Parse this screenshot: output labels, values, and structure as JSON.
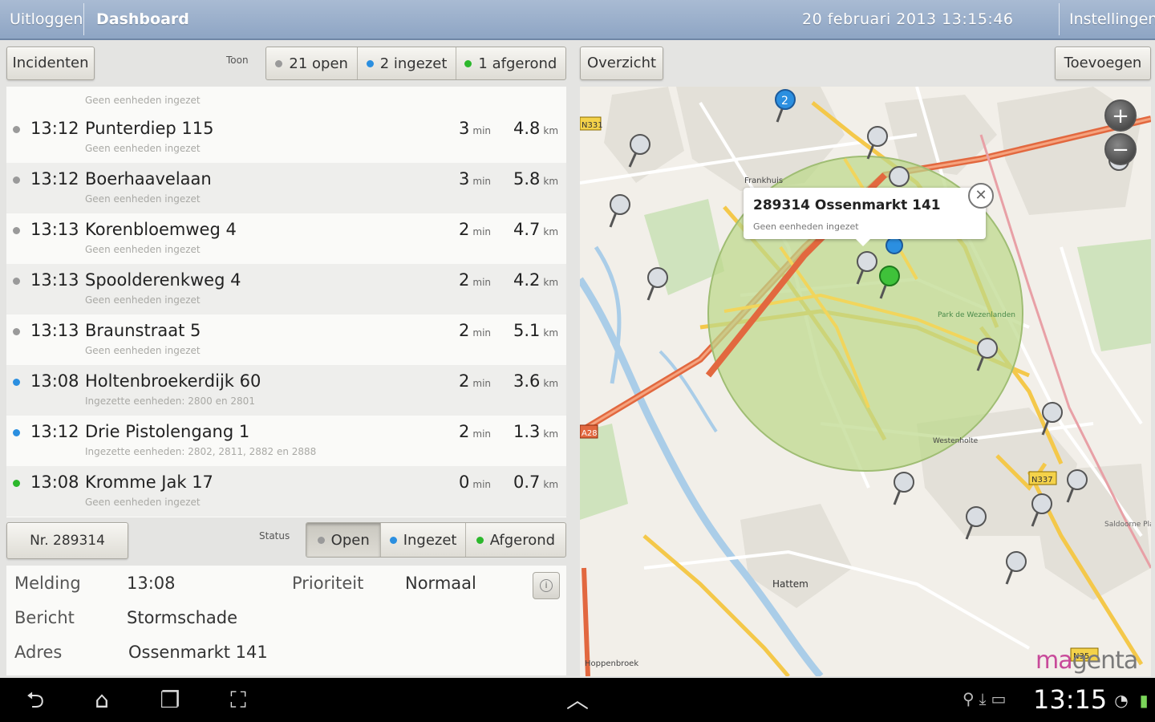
{
  "header": {
    "logout_label": "Uitloggen",
    "title": "Dashboard",
    "datetime": "20 februari 2013   13:15:46",
    "settings_label": "Instellingen"
  },
  "toolbar": {
    "incidents_label": "Incidenten",
    "show_label": "Toon",
    "filters": [
      {
        "label": "21 open",
        "dot_color": "#9a9a9a"
      },
      {
        "label": "2 ingezet",
        "dot_color": "#2b8fe0"
      },
      {
        "label": "1 afgerond",
        "dot_color": "#2cb82c"
      }
    ],
    "overview_label": "Overzicht",
    "add_label": "Toevoegen"
  },
  "list": {
    "top_cut_sub": "Geen eenheden ingezet",
    "rows": [
      {
        "status_color": "#9a9a9a",
        "time": "13:12",
        "address": "Punterdiep 115",
        "min": "3",
        "min_unit": "min",
        "km": "4.8",
        "km_unit": "km",
        "sub": "Geen eenheden ingezet"
      },
      {
        "status_color": "#9a9a9a",
        "time": "13:12",
        "address": "Boerhaavelaan",
        "min": "3",
        "min_unit": "min",
        "km": "5.8",
        "km_unit": "km",
        "sub": "Geen eenheden ingezet"
      },
      {
        "status_color": "#9a9a9a",
        "time": "13:13",
        "address": "Korenbloemweg 4",
        "min": "2",
        "min_unit": "min",
        "km": "4.7",
        "km_unit": "km",
        "sub": "Geen eenheden ingezet"
      },
      {
        "status_color": "#9a9a9a",
        "time": "13:13",
        "address": "Spoolderenkweg 4",
        "min": "2",
        "min_unit": "min",
        "km": "4.2",
        "km_unit": "km",
        "sub": "Geen eenheden ingezet"
      },
      {
        "status_color": "#9a9a9a",
        "time": "13:13",
        "address": "Braunstraat 5",
        "min": "2",
        "min_unit": "min",
        "km": "5.1",
        "km_unit": "km",
        "sub": "Geen eenheden ingezet"
      },
      {
        "status_color": "#2b8fe0",
        "time": "13:08",
        "address": "Holtenbroekerdijk 60",
        "min": "2",
        "min_unit": "min",
        "km": "3.6",
        "km_unit": "km",
        "sub": "Ingezette eenheden: 2800 en 2801"
      },
      {
        "status_color": "#2b8fe0",
        "time": "13:12",
        "address": "Drie Pistolengang 1",
        "min": "2",
        "min_unit": "min",
        "km": "1.3",
        "km_unit": "km",
        "sub": "Ingezette eenheden: 2802, 2811, 2882 en 2888"
      },
      {
        "status_color": "#2cb82c",
        "time": "13:08",
        "address": "Kromme Jak 17",
        "min": "0",
        "min_unit": "min",
        "km": "0.7",
        "km_unit": "km",
        "sub": "Geen eenheden ingezet"
      }
    ]
  },
  "detail_bar": {
    "number_label": "Nr. 289314",
    "status_label": "Status",
    "statuses": [
      {
        "label": "Open",
        "dot_color": "#9a9a9a",
        "active": true
      },
      {
        "label": "Ingezet",
        "dot_color": "#2b8fe0",
        "active": false
      },
      {
        "label": "Afgerond",
        "dot_color": "#2cb82c",
        "active": false
      }
    ]
  },
  "detail": {
    "melding_label": "Melding",
    "melding_value": "13:08",
    "priority_label": "Prioriteit",
    "priority_value": "Normaal",
    "bericht_label": "Bericht",
    "bericht_value": "Stormschade",
    "adres_label": "Adres",
    "adres_value": "Ossenmarkt 141"
  },
  "map": {
    "popup_title": "289314 Ossenmarkt 141",
    "popup_sub": "Geen eenheden ingezet",
    "zoom_in": "+",
    "zoom_out": "−",
    "place_hattem": "Hattem",
    "place_frankhuis": "Frankhuis",
    "place_park": "Park de Wezenlanden",
    "place_westenholte": "Westenholte",
    "place_saldoorne": "Saldoorne Plas",
    "place_papbarn": "Hoppenbroek",
    "road_a28": "A28",
    "road_n331": "N331",
    "road_n337": "N337",
    "road_n35": "N35",
    "pin_blue_number": "2",
    "logo_part1": "ma",
    "logo_part2": "genta",
    "region_color": "#bcd88a"
  },
  "navbar": {
    "clock": "13:15"
  }
}
